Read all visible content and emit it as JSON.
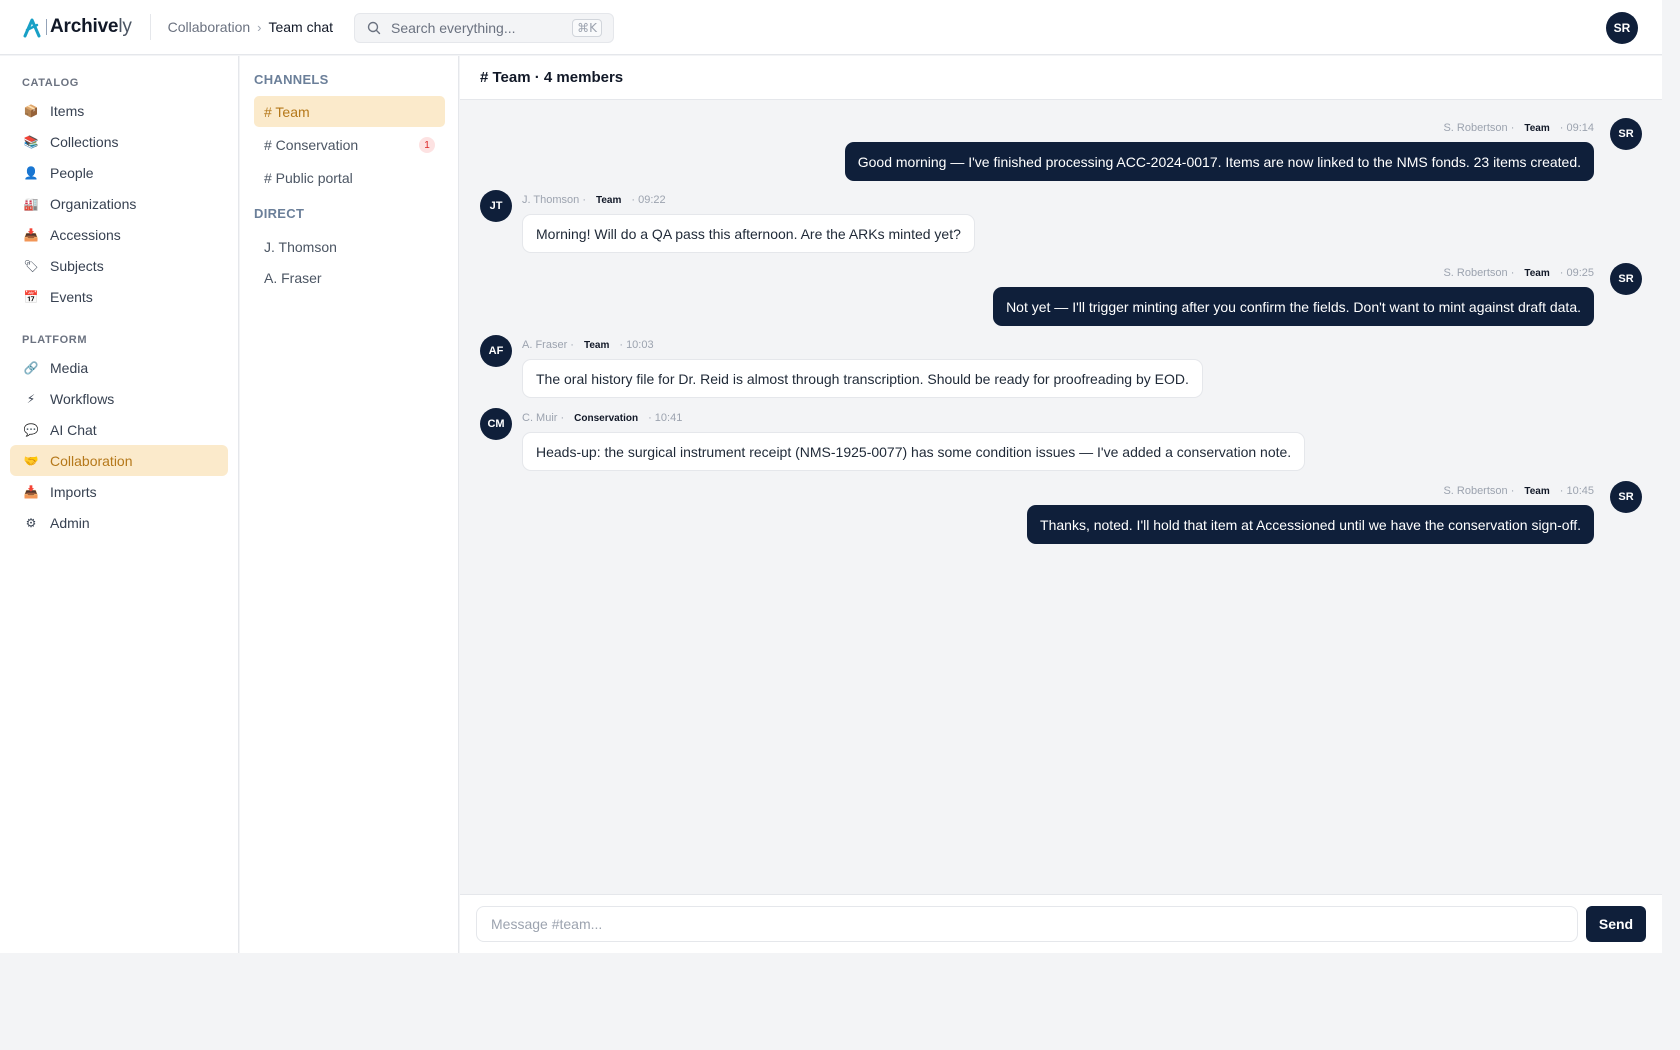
{
  "app": {
    "name_main": "Archive",
    "name_suffix": "ly"
  },
  "breadcrumb": {
    "parent": "Collaboration",
    "separator": "›",
    "current": "Team chat"
  },
  "search": {
    "placeholder": "Search everything...",
    "shortcut": "⌘K"
  },
  "user": {
    "initials": "SR"
  },
  "sidebar": {
    "catalog_heading": "CATALOG",
    "catalog_items": [
      {
        "label": "Items",
        "icon": "box-icon",
        "glyph": "📦"
      },
      {
        "label": "Collections",
        "icon": "collections-icon",
        "glyph": "📚"
      },
      {
        "label": "People",
        "icon": "person-icon",
        "glyph": "👤"
      },
      {
        "label": "Organizations",
        "icon": "building-icon",
        "glyph": "🏭"
      },
      {
        "label": "Accessions",
        "icon": "inbox-icon",
        "glyph": "📥"
      },
      {
        "label": "Subjects",
        "icon": "tag-icon",
        "glyph": "🏷"
      },
      {
        "label": "Events",
        "icon": "calendar-icon",
        "glyph": "📅"
      }
    ],
    "platform_heading": "PLATFORM",
    "platform_items": [
      {
        "label": "Media",
        "icon": "link-icon",
        "glyph": "🔗"
      },
      {
        "label": "Workflows",
        "icon": "lightning-icon",
        "glyph": "⚡"
      },
      {
        "label": "AI Chat",
        "icon": "speech-icon",
        "glyph": "💬"
      },
      {
        "label": "Collaboration",
        "icon": "handshake-icon",
        "glyph": "🤝",
        "active": true
      },
      {
        "label": "Imports",
        "icon": "import-icon",
        "glyph": "📥"
      },
      {
        "label": "Admin",
        "icon": "gear-icon",
        "glyph": "⚙"
      }
    ]
  },
  "channels": {
    "heading": "CHANNELS",
    "items": [
      {
        "label": "# Team",
        "active": true
      },
      {
        "label": "# Conservation",
        "badge": "1"
      },
      {
        "label": "# Public portal"
      }
    ],
    "direct_heading": "DIRECT",
    "direct": [
      {
        "label": "J. Thomson"
      },
      {
        "label": "A. Fraser"
      }
    ]
  },
  "chat": {
    "header": "# Team · 4 members",
    "messages": [
      {
        "initials": "SR",
        "author": "S. Robertson ·",
        "channel": "Team",
        "time": "· 09:14",
        "text": "Good morning — I've finished processing ACC-2024-0017. Items are now linked to the NMS fonds. 23 items created.",
        "outgoing": true
      },
      {
        "initials": "JT",
        "author": "J. Thomson ·",
        "channel": "Team",
        "time": "· 09:22",
        "text": "Morning! Will do a QA pass this afternoon. Are the ARKs minted yet?",
        "outgoing": false
      },
      {
        "initials": "SR",
        "author": "S. Robertson ·",
        "channel": "Team",
        "time": "· 09:25",
        "text": "Not yet — I'll trigger minting after you confirm the fields. Don't want to mint against draft data.",
        "outgoing": true
      },
      {
        "initials": "AF",
        "author": "A. Fraser ·",
        "channel": "Team",
        "time": "· 10:03",
        "text": "The oral history file for Dr. Reid is almost through transcription. Should be ready for proofreading by EOD.",
        "outgoing": false
      },
      {
        "initials": "CM",
        "author": "C. Muir ·",
        "channel": "Conservation",
        "time": "· 10:41",
        "text": "Heads-up: the surgical instrument receipt (NMS-1925-0077) has some condition issues — I've added a conservation note.",
        "outgoing": false
      },
      {
        "initials": "SR",
        "author": "S. Robertson ·",
        "channel": "Team",
        "time": "· 10:45",
        "text": "Thanks, noted. I'll hold that item at Accessioned until we have the conservation sign-off.",
        "outgoing": true
      }
    ],
    "composer_placeholder": "Message #team...",
    "send_label": "Send"
  },
  "colors": {
    "accent": "#b5781a",
    "accent_bg": "#fbeacb",
    "navy": "#0f1f3a",
    "logo": "#18a0c6"
  }
}
